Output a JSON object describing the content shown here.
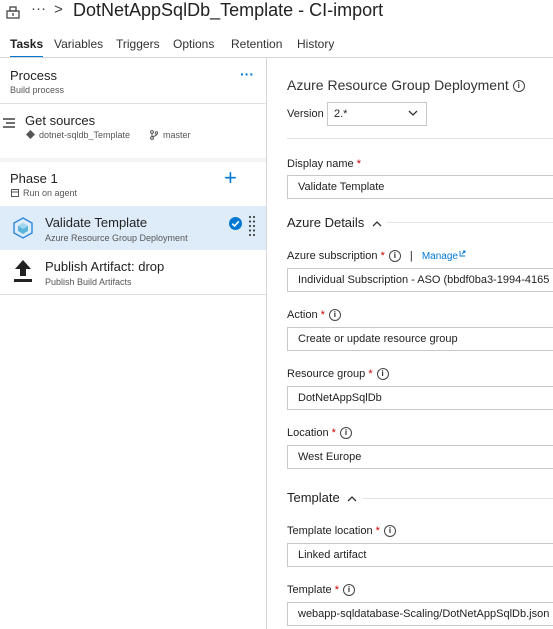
{
  "header": {
    "breadcrumb_ellipsis": "···",
    "chevron": ">",
    "title": "DotNetAppSqlDb_Template - CI-import"
  },
  "tabs": [
    {
      "label": "Tasks",
      "active": true
    },
    {
      "label": "Variables"
    },
    {
      "label": "Triggers"
    },
    {
      "label": "Options"
    },
    {
      "label": "Retention"
    },
    {
      "label": "History"
    }
  ],
  "process": {
    "title": "Process",
    "subtitle": "Build process",
    "more": "···"
  },
  "get_sources": {
    "title": "Get sources",
    "repo": "dotnet-sqldb_Template",
    "branch": "master"
  },
  "phase": {
    "title": "Phase 1",
    "subtitle": "Run on agent",
    "add": "+"
  },
  "tasks": [
    {
      "title": "Validate Template",
      "subtitle": "Azure Resource Group Deployment",
      "icon": "azure-resource-group-icon",
      "selected": true
    },
    {
      "title": "Publish Artifact: drop",
      "subtitle": "Publish Build Artifacts",
      "icon": "upload-arrow-icon"
    }
  ],
  "panel": {
    "title": "Azure Resource Group Deployment",
    "version_label": "Version",
    "version_value": "2.*",
    "display_name_label": "Display name",
    "display_name_value": "Validate Template",
    "azure_details_header": "Azure Details",
    "subscription_label": "Azure subscription",
    "separator": "|",
    "manage_link": "Manage",
    "subscription_value": "Individual Subscription - ASO (bbdf0ba3-1994-4165",
    "action_label": "Action",
    "action_value": "Create or update resource group",
    "resource_group_label": "Resource group",
    "resource_group_value": "DotNetAppSqlDb",
    "location_label": "Location",
    "location_value": "West Europe",
    "template_header": "Template",
    "template_location_label": "Template location",
    "template_location_value": "Linked artifact",
    "template_label": "Template",
    "template_value": "webapp-sqldatabase-Scaling/DotNetAppSqlDb.json"
  },
  "colors": {
    "accent": "#0078d4",
    "selected_row": "#deecf9",
    "required": "#cc0000"
  }
}
